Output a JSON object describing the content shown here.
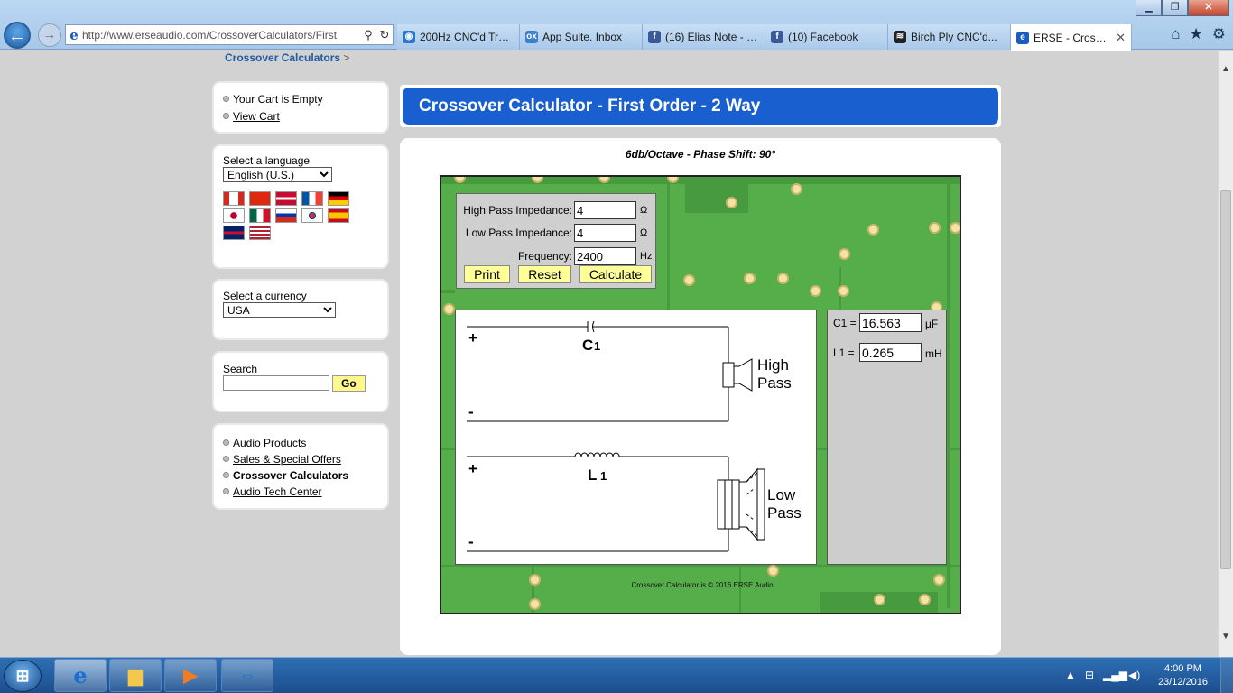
{
  "browser": {
    "url": "http://www.erseaudio.com/CrossoverCalculators/First",
    "tabs": [
      {
        "label": "200Hz CNC'd Trac...",
        "icon": "globe-icon",
        "color": "#2a76c9"
      },
      {
        "label": "App Suite. Inbox",
        "icon": "ox-icon",
        "color": "#3b7fcf"
      },
      {
        "label": "(16) Elias Note - Eli...",
        "icon": "facebook-icon",
        "color": "#3b5998"
      },
      {
        "label": "(10) Facebook",
        "icon": "facebook-icon",
        "color": "#3b5998"
      },
      {
        "label": "Birch Ply CNC'd...",
        "icon": "signal-icon",
        "color": "#222222"
      },
      {
        "label": "ERSE - Crossov...",
        "icon": "ie-icon",
        "color": "#1a5cc2"
      }
    ]
  },
  "breadcrumb": {
    "link": "Crossover Calculators",
    "sep": ">"
  },
  "cart": {
    "status": "Your Cart is Empty",
    "view_link": "View Cart"
  },
  "language": {
    "label": "Select a language",
    "selected": "English (U.S.)"
  },
  "currency": {
    "label": "Select a currency",
    "selected": "USA"
  },
  "search": {
    "label": "Search",
    "button": "Go",
    "value": ""
  },
  "nav": [
    {
      "label": "Audio Products",
      "active": false
    },
    {
      "label": "Sales & Special Offers",
      "active": false
    },
    {
      "label": "Crossover Calculators",
      "active": true
    },
    {
      "label": "Audio Tech Center",
      "active": false
    }
  ],
  "calculator": {
    "title": "Crossover Calculator - First Order - 2 Way",
    "subtitle": "6db/Octave - Phase Shift: 90°",
    "high_pass_label": "High Pass Impedance:",
    "high_pass_value": "4",
    "low_pass_label": "Low Pass Impedance:",
    "low_pass_value": "4",
    "ohm": "Ω",
    "frequency_label": "Frequency:",
    "frequency_value": "2400",
    "hz": "Hz",
    "print": "Print",
    "reset": "Reset",
    "calculate": "Calculate",
    "c1_label": "C1 =",
    "c1_value": "16.563",
    "c1_unit": "μF",
    "l1_label": "L1 =",
    "l1_value": "0.265",
    "l1_unit": "mH",
    "diagram": {
      "plus": "+",
      "minus": "-",
      "cap_label": "C",
      "cap_sub": "1",
      "ind_label": "L",
      "ind_sub": "1",
      "high1": "High",
      "high2": "Pass",
      "low1": "Low",
      "low2": "Pass"
    },
    "copyright": "Crossover Calculator is © 2016 ERSE Audio"
  },
  "taskbar": {
    "time": "4:00 PM",
    "date": "23/12/2016"
  },
  "colors": {
    "title_blue": "#1a5fcf",
    "pcb_green": "#55ae4a",
    "button_yellow": "#ffff99"
  }
}
